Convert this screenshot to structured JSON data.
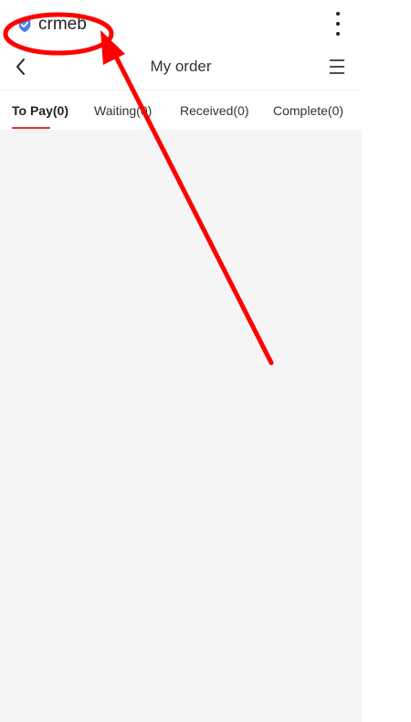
{
  "app": {
    "name": "crmeb"
  },
  "header": {
    "title": "My order"
  },
  "tabs": [
    {
      "label": "To Pay(0)",
      "active": true
    },
    {
      "label": "Waiting(0)",
      "active": false
    },
    {
      "label": "Received(0)",
      "active": false
    },
    {
      "label": "Complete(0)",
      "active": false
    }
  ],
  "colors": {
    "accent": "#e93323",
    "verified": "#4a7cf0",
    "annotation": "#ff0000",
    "content_bg": "#f5f5f5"
  },
  "icons": {
    "verified": "verified-check-icon",
    "more": "more-vertical-icon",
    "back": "chevron-left-icon",
    "menu": "hamburger-menu-icon"
  }
}
